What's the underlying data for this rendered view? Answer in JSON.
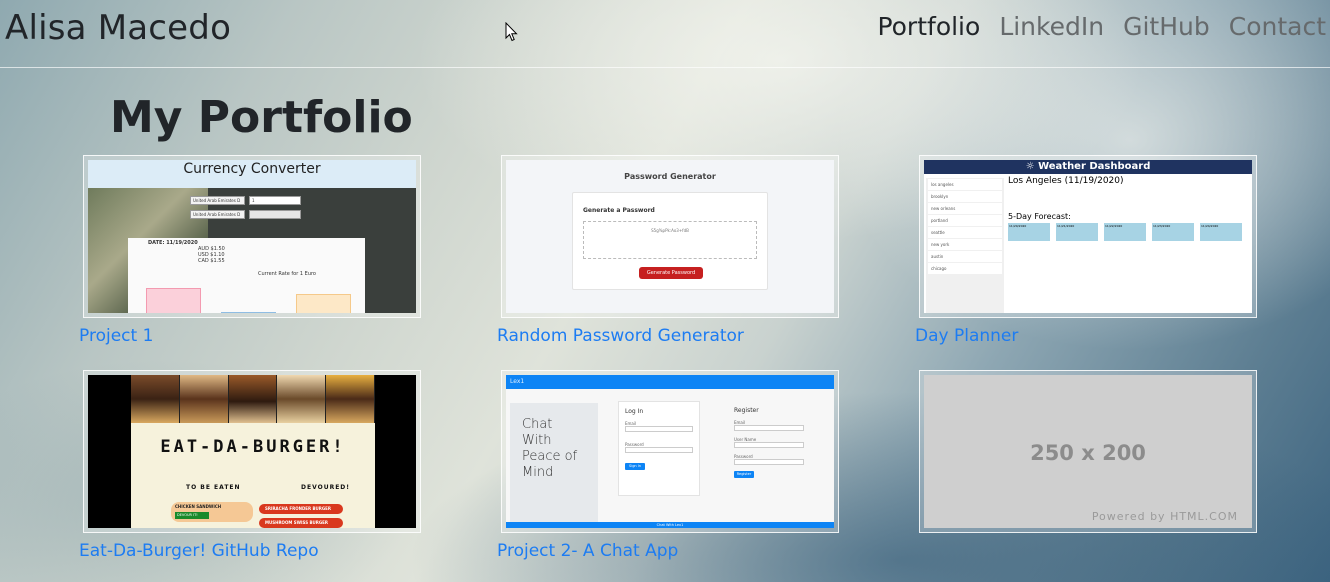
{
  "header": {
    "brand": "Alisa Macedo",
    "nav": [
      {
        "label": "Portfolio",
        "active": true
      },
      {
        "label": "LinkedIn",
        "active": false
      },
      {
        "label": "GitHub",
        "active": false
      },
      {
        "label": "Contact",
        "active": false
      }
    ]
  },
  "main": {
    "title": "My Portfolio",
    "projects": [
      {
        "link": "Project 1",
        "thumb": {
          "heading": "Currency Converter",
          "select_1": "United Arab Emirates D",
          "input_1": "1",
          "select_2": "United Arab Emirates D",
          "date": "DATE: 11/19/2020",
          "rates": [
            "AUD $1.50",
            "USD $1.10",
            "CAD $1.55"
          ],
          "legend": "Current Rate for 1 Euro"
        }
      },
      {
        "link": "Random Password Generator",
        "thumb": {
          "heading": "Password Generator",
          "card_title": "Generate a Password",
          "password": "S5g%pPk:Ao3+fdB",
          "button": "Generate Password"
        }
      },
      {
        "link": "Day Planner",
        "thumb": {
          "heading": "Weather Dashboard",
          "city": "Los Angeles (11/19/2020)",
          "forecast": "5-Day Forecast:",
          "cities": [
            "los angeles",
            "brooklyn",
            "new orleans",
            "portland",
            "seattle",
            "new york",
            "austin",
            "chicago"
          ],
          "days": [
            "11/20/2020",
            "11/21/2020",
            "11/22/2020",
            "11/23/2020",
            "11/24/2020"
          ]
        }
      },
      {
        "link": "Eat-Da-Burger! GitHub Repo",
        "thumb": {
          "title": "EAT-DA-BURGER!",
          "col_left": "TO BE EATEN",
          "col_right": "DEVOURED!",
          "left_item": "CHICKEN SANDWICH",
          "left_button": "DEVOUR IT!",
          "right_items": [
            "SRIRACHA FRONDER BURGER",
            "MUSHROOM SWISS BURGER"
          ]
        }
      },
      {
        "link": "Project 2- A Chat App",
        "thumb": {
          "topbar": "Lex1",
          "hero": "Chat With Peace of Mind",
          "login": "Log In",
          "login_fields": [
            "Email",
            "Password"
          ],
          "login_button": "Sign In",
          "register": "Register",
          "register_fields": [
            "Email",
            "User Name",
            "Password"
          ],
          "register_button": "Register",
          "footer": "Chat With Lex1"
        }
      },
      {
        "link": "",
        "thumb": {
          "placeholder": "250 x 200",
          "powered": "Powered by HTML.COM"
        }
      }
    ]
  },
  "colors": {
    "link": "#1d7cf2",
    "text": "#212529",
    "nav_inactive": "#666a6c"
  }
}
